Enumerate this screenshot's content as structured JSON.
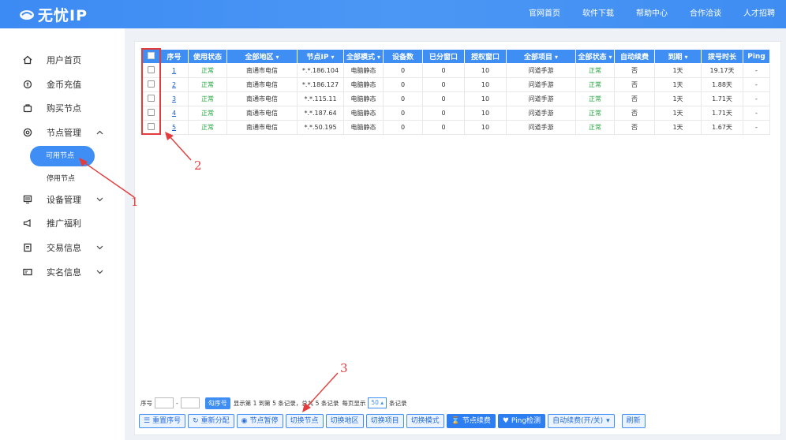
{
  "header": {
    "logo_text": "无忧IP",
    "nav": [
      "官网首页",
      "软件下载",
      "帮助中心",
      "合作洽谈",
      "人才招聘"
    ]
  },
  "sidebar": {
    "items": [
      {
        "label": "用户首页",
        "icon": "home-icon"
      },
      {
        "label": "金币充值",
        "icon": "coin-icon"
      },
      {
        "label": "购买节点",
        "icon": "bag-icon"
      },
      {
        "label": "节点管理",
        "icon": "target-icon",
        "expanded": true
      },
      {
        "label": "设备管理",
        "icon": "monitor-icon"
      },
      {
        "label": "推广福利",
        "icon": "megaphone-icon"
      },
      {
        "label": "交易信息",
        "icon": "document-icon"
      },
      {
        "label": "实名信息",
        "icon": "id-card-icon"
      }
    ],
    "sub_items": [
      "可用节点",
      "停用节点"
    ],
    "active_sub": "可用节点"
  },
  "table": {
    "headers": [
      "序号",
      "使用状态",
      "全部地区",
      "节点IP",
      "全部模式",
      "设备数",
      "已分窗口",
      "授权窗口",
      "全部项目",
      "全部状态",
      "自动续费",
      "到期",
      "拨号时长",
      "Ping"
    ],
    "rows": [
      [
        "1",
        "正常",
        "南通市电信",
        "*.*.186.104",
        "电脑静态",
        "0",
        "0",
        "10",
        "问道手游",
        "正常",
        "否",
        "1天",
        "19.17天",
        "-"
      ],
      [
        "2",
        "正常",
        "南通市电信",
        "*.*.186.127",
        "电脑静态",
        "0",
        "0",
        "10",
        "问道手游",
        "正常",
        "否",
        "1天",
        "1.88天",
        "-"
      ],
      [
        "3",
        "正常",
        "南通市电信",
        "*.*.115.11",
        "电脑静态",
        "0",
        "0",
        "10",
        "问道手游",
        "正常",
        "否",
        "1天",
        "1.71天",
        "-"
      ],
      [
        "4",
        "正常",
        "南通市电信",
        "*.*.187.64",
        "电脑静态",
        "0",
        "0",
        "10",
        "问道手游",
        "正常",
        "否",
        "1天",
        "1.71天",
        "-"
      ],
      [
        "5",
        "正常",
        "南通市电信",
        "*.*.50.195",
        "电脑静态",
        "0",
        "0",
        "10",
        "问道手游",
        "正常",
        "否",
        "1天",
        "1.67天",
        "-"
      ]
    ]
  },
  "pager": {
    "label_seq": "序号",
    "dash": "-",
    "check_button": "勾序号",
    "summary": "显示第 1 到第 5 条记录，总共 5 条记录",
    "per_page_label": "每页显示",
    "per_page_value": "50",
    "per_page_suffix": "条记录"
  },
  "toolbar": [
    {
      "label": "重置序号",
      "icon": "list-icon",
      "solid": false
    },
    {
      "label": "重新分配",
      "icon": "refresh-icon",
      "solid": false
    },
    {
      "label": "节点暂停",
      "icon": "pause-icon",
      "solid": false
    },
    {
      "label": "切换节点",
      "icon": "",
      "solid": false
    },
    {
      "label": "切换地区",
      "icon": "",
      "solid": false
    },
    {
      "label": "切换项目",
      "icon": "",
      "solid": false
    },
    {
      "label": "切换模式",
      "icon": "",
      "solid": false
    },
    {
      "label": "节点续费",
      "icon": "hourglass-icon",
      "solid": true
    },
    {
      "label": "Ping检测",
      "icon": "heart-icon",
      "solid": true
    },
    {
      "label": "自动续费(开/关)",
      "icon": "",
      "solid": false,
      "dropdown": true
    },
    {
      "label": "刷新",
      "icon": "",
      "solid": false
    }
  ],
  "annotations": [
    "1",
    "2",
    "3"
  ],
  "colors": {
    "brand": "#3e8ef3",
    "status_ok": "#22a43d",
    "annotation": "#e43c3c"
  }
}
